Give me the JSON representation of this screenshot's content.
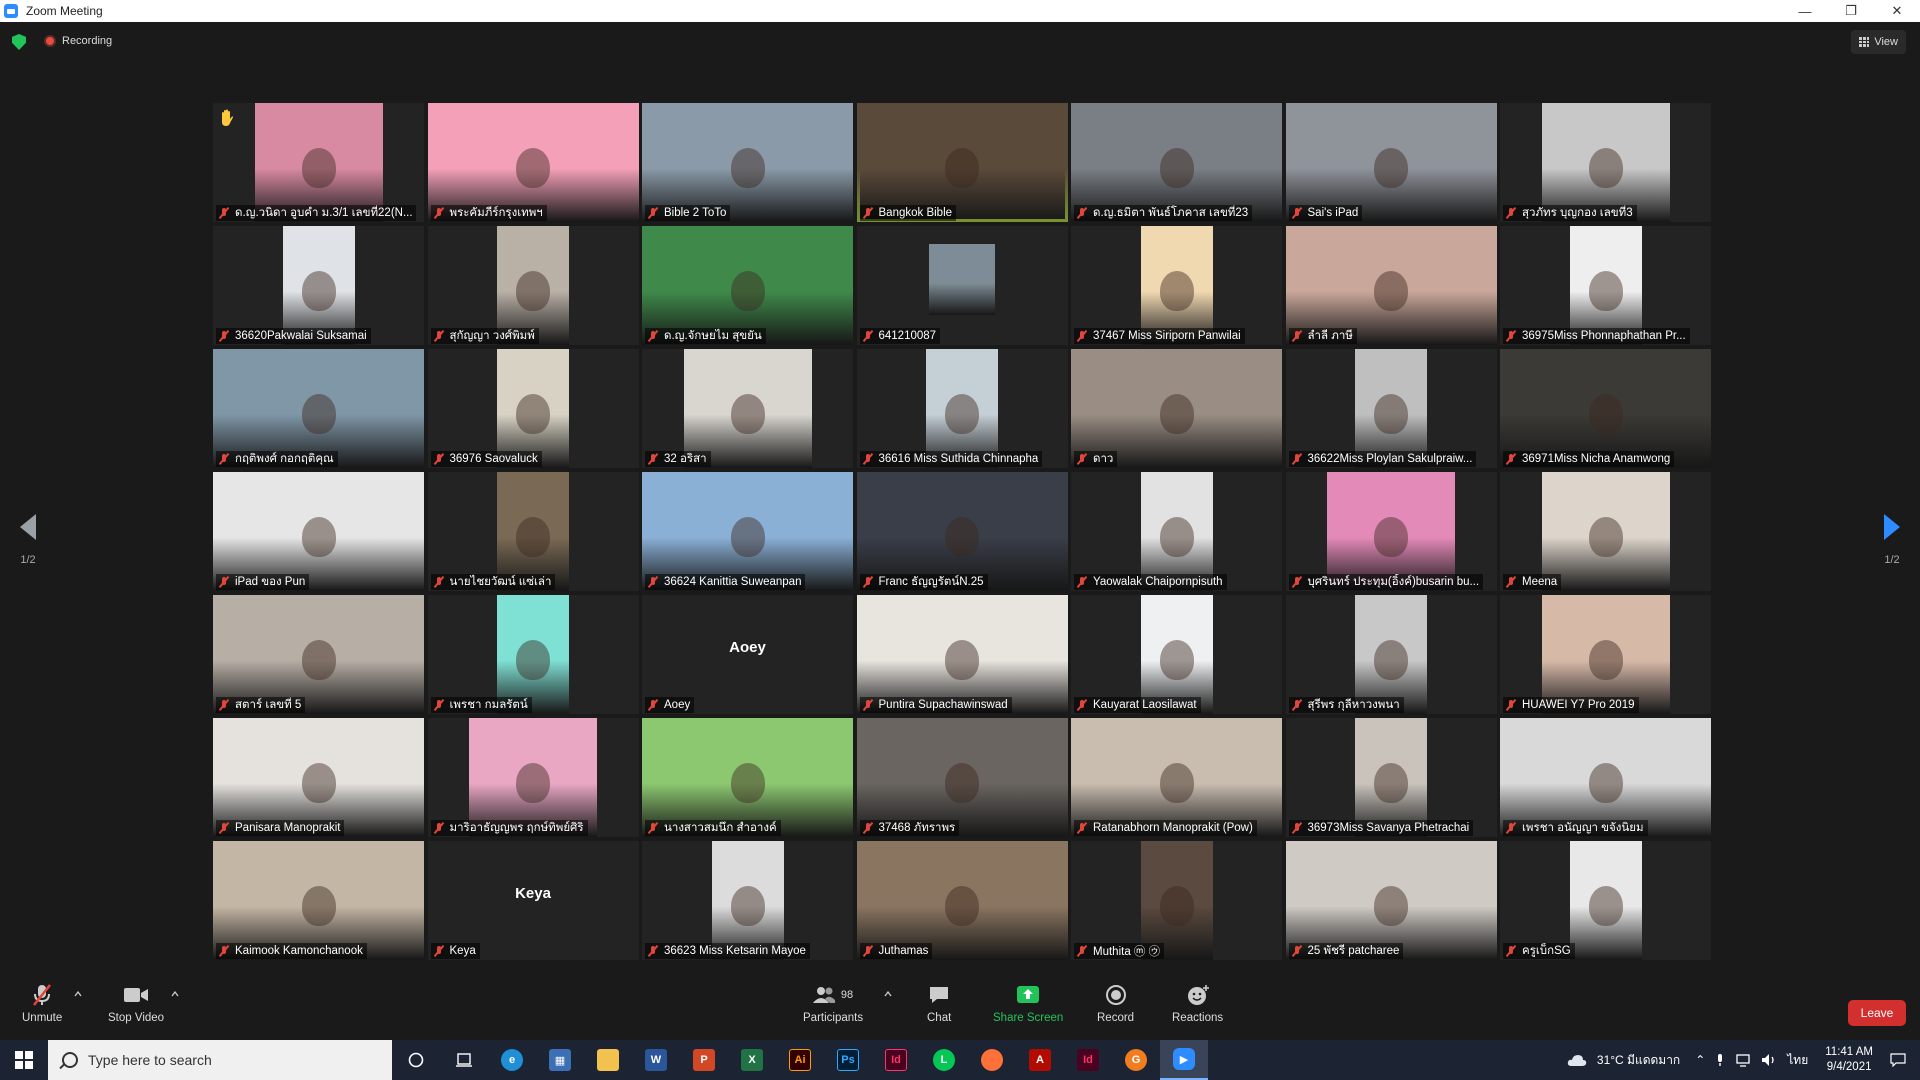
{
  "window": {
    "title": "Zoom Meeting"
  },
  "topbar": {
    "recording_label": "Recording",
    "view_label": "View"
  },
  "pager": {
    "left": "1/2",
    "right": "1/2"
  },
  "participants": [
    {
      "name": "ด.ญ.วนิดา อูบคำ ม.3/1 เลขที่22(N...",
      "bg": "#d98aa3",
      "w": 128,
      "hand": true
    },
    {
      "name": "พระคัมภีร์กรุงเทพฯ",
      "bg": "#f4a0b8",
      "w": 170
    },
    {
      "name": "Bible 2 ToTo",
      "bg": "#8a9aa8",
      "w": 170
    },
    {
      "name": "Bangkok Bible",
      "bg": "#5a4a3a",
      "w": 170,
      "active": true
    },
    {
      "name": "ด.ญ.ธมิตา พันธ์โภคาส เลขที่23",
      "bg": "#7a7f86",
      "w": 170
    },
    {
      "name": "Sai's iPad",
      "bg": "#8f939a",
      "w": 170
    },
    {
      "name": "สุวภัทร บุญกอง เลขที่3",
      "bg": "#c8c8c8",
      "w": 128
    },
    {
      "name": "36620Pakwalai Suksamai",
      "bg": "#dfe2e6",
      "w": 72
    },
    {
      "name": "สุกัญญา วงศ์พิมพ์",
      "bg": "#b9b0a6",
      "w": 72
    },
    {
      "name": "ด.ญ.จักษยไม สุขยัน",
      "bg": "#3f8a4a",
      "w": 170
    },
    {
      "name": "641210087",
      "bg": "#7d8c96",
      "w": 66,
      "short": true
    },
    {
      "name": "37467 Miss Siriporn Panwilai",
      "bg": "#f0d8b0",
      "w": 72
    },
    {
      "name": "ลำลี ภาษี",
      "bg": "#c9a79a",
      "w": 170
    },
    {
      "name": "36975Miss Phonnaphathan Pr...",
      "bg": "#eeeeee",
      "w": 72
    },
    {
      "name": "กฤติพงศ์ กอกฤติคุณ",
      "bg": "#8097a8",
      "w": 170
    },
    {
      "name": "36976 Saovaluck",
      "bg": "#d7d2c4",
      "w": 72
    },
    {
      "name": "32 อริสา",
      "bg": "#d9d6d0",
      "w": 128
    },
    {
      "name": "36616 Miss Suthida Chinnapha",
      "bg": "#c5cfd6",
      "w": 72
    },
    {
      "name": "ดาว",
      "bg": "#9a8e84",
      "w": 170
    },
    {
      "name": "36622Miss Ploylan Sakulpraiw...",
      "bg": "#bfbfbf",
      "w": 72
    },
    {
      "name": "36971Miss Nicha Anamwong",
      "bg": "#3c3a36",
      "w": 170
    },
    {
      "name": "iPad ของ Pun",
      "bg": "#e6e6e6",
      "w": 170
    },
    {
      "name": "นายไชยวัฒน์ แซ่เล่า",
      "bg": "#7a6a55",
      "w": 72
    },
    {
      "name": "36624 Kanittia Suweanpan",
      "bg": "#8ab0d6",
      "w": 170
    },
    {
      "name": "Franc ธัญญรัตน์N.25",
      "bg": "#3a3e48",
      "w": 170
    },
    {
      "name": "Yaowalak Chaipornpisuth",
      "bg": "#e2e2e2",
      "w": 72
    },
    {
      "name": "บุศรินทร์ ประทุม(อิ้งค์)busarin bu...",
      "bg": "#e48ab8",
      "w": 128
    },
    {
      "name": "Meena",
      "bg": "#ddd5cb",
      "w": 128
    },
    {
      "name": "สตาร์ เลขที่ 5",
      "bg": "#b7aea5",
      "w": 170
    },
    {
      "name": "เพรชา กมลรัตน์",
      "bg": "#7fe0d4",
      "w": 72
    },
    {
      "name": "Aoey",
      "bg": "",
      "w": 0,
      "text_only": "Aoey"
    },
    {
      "name": "Puntira Supachawinswad",
      "bg": "#e8e4de",
      "w": 170
    },
    {
      "name": "Kauyarat Laosilawat",
      "bg": "#eef0f2",
      "w": 72
    },
    {
      "name": "สุรีพร กุลีหาวงพนา",
      "bg": "#c8c8c8",
      "w": 72
    },
    {
      "name": "HUAWEI Y7 Pro 2019",
      "bg": "#d7b9a8",
      "w": 128
    },
    {
      "name": "Panisara Manoprakit",
      "bg": "#e5e2de",
      "w": 170
    },
    {
      "name": "มาริอาธัญญพร ฤกษ์ทิพย์ศิริ",
      "bg": "#e9a7c4",
      "w": 128
    },
    {
      "name": "นางสาวสมนึก สำอางค์",
      "bg": "#8cc870",
      "w": 170
    },
    {
      "name": "37468 ภัทราพร",
      "bg": "#6a6560",
      "w": 170
    },
    {
      "name": "Ratanabhorn Manoprakit (Pow)",
      "bg": "#c9bdb0",
      "w": 170
    },
    {
      "name": "36973Miss Savanya Phetrachai",
      "bg": "#c9c3bc",
      "w": 72
    },
    {
      "name": "เพรชา อนัญญา ขจังนิยม",
      "bg": "#d9d9d9",
      "w": 170
    },
    {
      "name": "Kaimook Kamonchanook",
      "bg": "#c4b6a4",
      "w": 170
    },
    {
      "name": "Keya",
      "bg": "",
      "w": 0,
      "text_only": "Keya"
    },
    {
      "name": "36623 Miss Ketsarin Mayoe",
      "bg": "#dcdcdc",
      "w": 72
    },
    {
      "name": "Juthamas",
      "bg": "#8a7560",
      "w": 170
    },
    {
      "name": "Muthita ⓜ ㋒",
      "bg": "#5a4a3f",
      "w": 72
    },
    {
      "name": "25 พัชรี patcharee",
      "bg": "#cfcac4",
      "w": 170
    },
    {
      "name": "ครูเบ็กSG",
      "bg": "#e8e8e8",
      "w": 72
    }
  ],
  "toolbar": {
    "unmute": "Unmute",
    "stop_video": "Stop Video",
    "participants": "Participants",
    "participants_count": "98",
    "chat": "Chat",
    "share_screen": "Share Screen",
    "record": "Record",
    "reactions": "Reactions",
    "leave": "Leave"
  },
  "taskbar": {
    "search_placeholder": "Type here to search",
    "weather": "31°C มีแดดมาก",
    "lang": "ไทย",
    "time": "11:41 AM",
    "date": "9/4/2021"
  },
  "colors": {
    "accent_green": "#23c35b",
    "active_speaker": "#b8e34b",
    "leave": "#d32f2f",
    "mic_off": "#e0463a"
  }
}
